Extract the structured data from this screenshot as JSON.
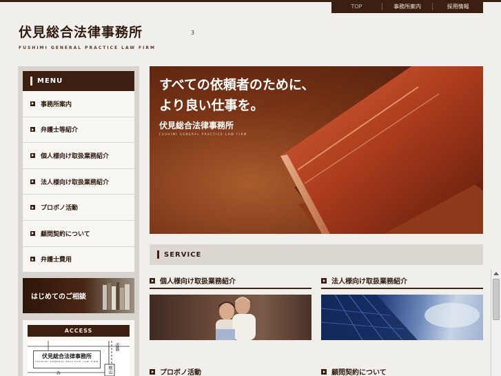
{
  "topnav": {
    "items": [
      "TOP",
      "事務所案内",
      "採用情報"
    ]
  },
  "brand": {
    "title": "伏見総合法律事務所",
    "subtitle": "FUSHIMI GENERAL PRACTICE LAW FIRM"
  },
  "stray_number": "3",
  "sidebar": {
    "menu_title": "MENU",
    "items": [
      {
        "label": "事務所案内"
      },
      {
        "label": "弁護士等紹介"
      },
      {
        "label": "個人様向け取扱業務紹介"
      },
      {
        "label": "法人様向け取扱業務紹介"
      },
      {
        "label": "プロボノ活動"
      },
      {
        "label": "顧問契約について"
      },
      {
        "label": "弁護士費用"
      }
    ],
    "consult_label": "はじめてのご相談",
    "access_title": "ACCESS",
    "map": {
      "firm": "伏見総合法律事務所",
      "firm_sub": "FUSHIMI GENERAL PRACTICE LAW FIRM",
      "rail": "近鉄",
      "station": "桃山",
      "road": "み"
    }
  },
  "hero": {
    "line1": "すべての依頼者のために、",
    "line2": "より良い仕事を。",
    "brand": "伏見総合法律事務所",
    "brand_sub": "FUSHIMI GENERAL PRACTICE LAW FIRM"
  },
  "service": {
    "title": "SERVICE",
    "cards": [
      {
        "title": "個人様向け取扱業務紹介"
      },
      {
        "title": "法人様向け取扱業務紹介"
      },
      {
        "title": "プロボノ活動"
      },
      {
        "title": "顧問契約について"
      }
    ]
  },
  "colors": {
    "brand_brown": "#3b2012",
    "page_bg": "#f1efeb",
    "sidebar_bg": "#d8d3cc"
  }
}
